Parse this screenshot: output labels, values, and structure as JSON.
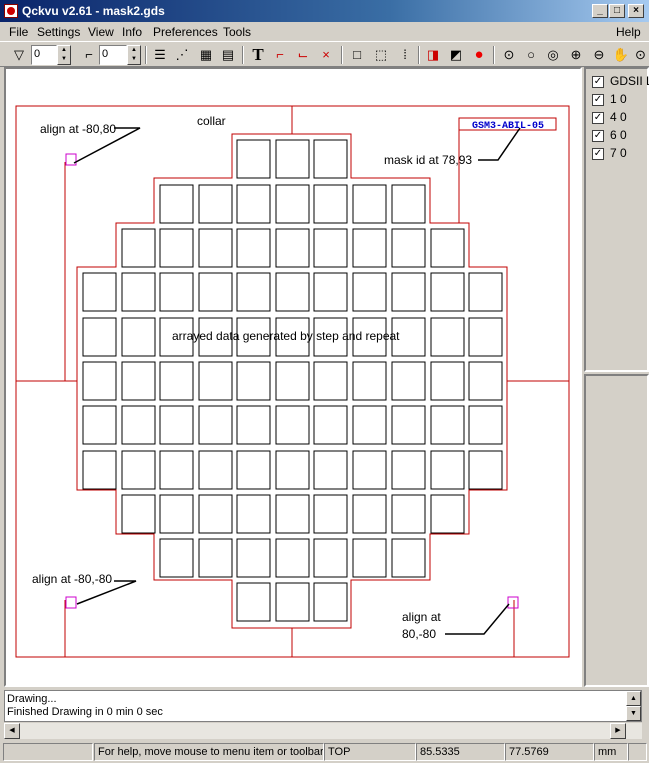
{
  "window": {
    "title": "Qckvu v2.61 - mask2.gds"
  },
  "menu": [
    "File",
    "Settings",
    "View",
    "Info",
    "Preferences",
    "Tools"
  ],
  "menu_help": "Help",
  "toolbar": {
    "filter_value": "0",
    "depth_value": "0",
    "icons": [
      "filter-icon",
      "hierarchy-icon",
      "layers-stack-icon",
      "cell-tree-icon",
      "grid-cells-icon",
      "table-icon",
      "text-icon",
      "ruler-icon",
      "measure-icon",
      "clear-ruler-icon",
      "box-icon",
      "dotted-box-icon",
      "dots-grid-icon",
      "select-cell-icon",
      "select-edit-icon",
      "stop-icon",
      "zoom-fit-icon",
      "zoom-icon",
      "zoom-box-icon",
      "zoom-in-icon",
      "zoom-out-icon",
      "pan-hand-icon",
      "zoom-extra-icon"
    ]
  },
  "canvas": {
    "labels": {
      "collar": "collar",
      "align_tl": "align at -80,80",
      "mask_id": "mask id at 78,93",
      "arrayed": "arrayed data generated by step and repeat",
      "align_bl": "align at -80,-80",
      "align_br_1": "align at",
      "align_br_2": "80,-80",
      "mask_id_text": "GSM3-ABIL-05"
    },
    "colors": {
      "outline": "#c00000",
      "cell": "#000000",
      "marker": "#cc00cc",
      "maskid": "#0000cc"
    }
  },
  "layers": [
    {
      "checked": true,
      "label": "GDSII L"
    },
    {
      "checked": true,
      "label": "1  0"
    },
    {
      "checked": true,
      "label": "4  0"
    },
    {
      "checked": true,
      "label": "6  0"
    },
    {
      "checked": true,
      "label": "7  0"
    }
  ],
  "log": [
    "Drawing...",
    "Finished Drawing in 0 min 0 sec"
  ],
  "statusbar": {
    "help": "For help, move mouse to menu item or toolbar b",
    "cell": "TOP",
    "x": "85.5335",
    "y": "77.5769",
    "units": "mm"
  }
}
